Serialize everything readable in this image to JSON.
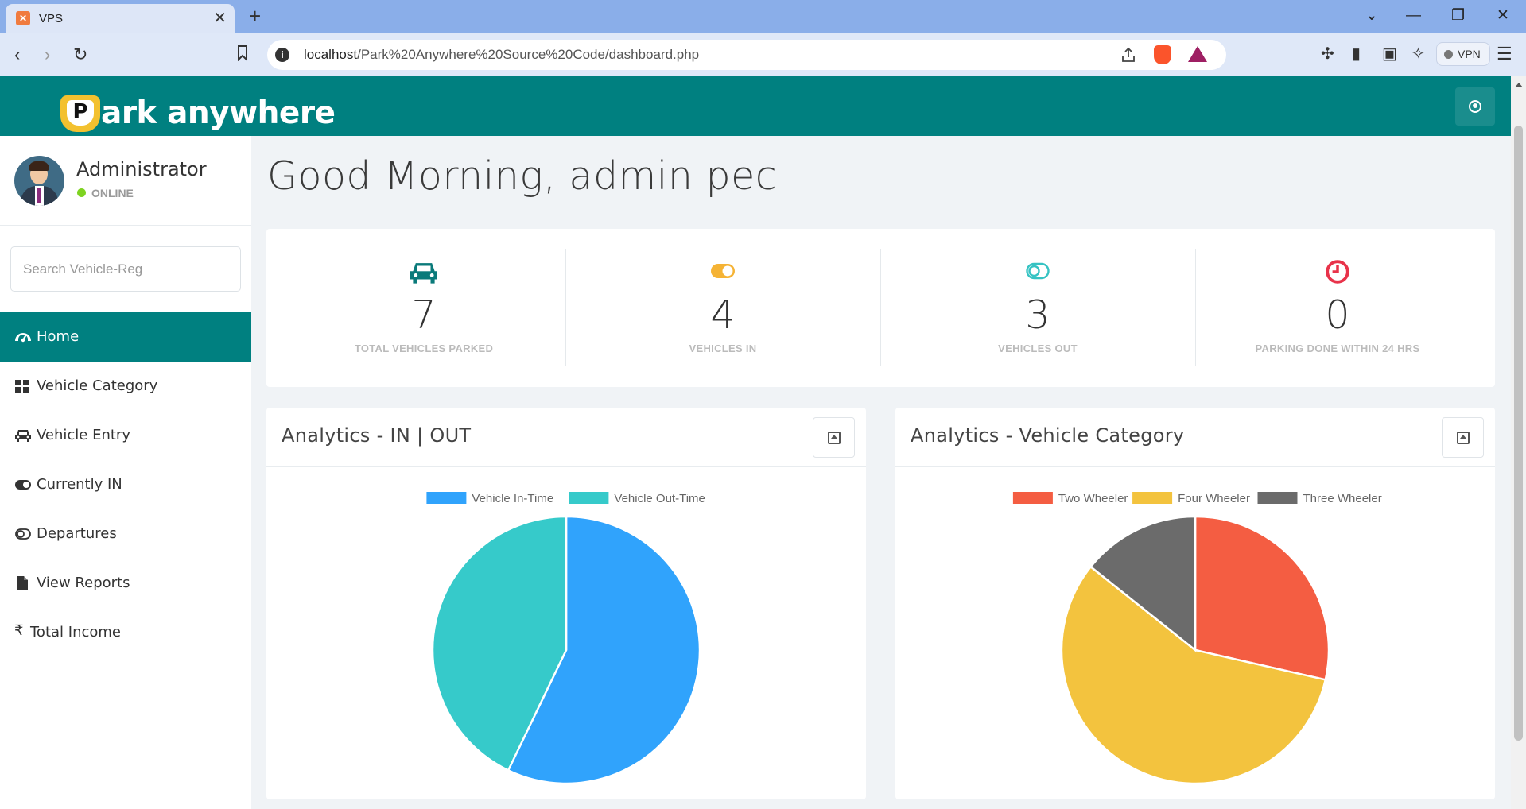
{
  "browser": {
    "tab_title": "VPS",
    "url_host": "localhost",
    "url_path": "/Park%20Anywhere%20Source%20Code/dashboard.php",
    "vpn_label": "VPN"
  },
  "header": {
    "logo_letter": "P",
    "logo_text": "ark anywhere"
  },
  "sidebar": {
    "profile_name": "Administrator",
    "status": "ONLINE",
    "search_placeholder": "Search Vehicle-Reg",
    "items": [
      {
        "label": "Home",
        "icon": "dashboard-icon"
      },
      {
        "label": "Vehicle Category",
        "icon": "grid-icon"
      },
      {
        "label": "Vehicle Entry",
        "icon": "car-icon"
      },
      {
        "label": "Currently IN",
        "icon": "toggle-on-icon"
      },
      {
        "label": "Departures",
        "icon": "toggle-off-icon"
      },
      {
        "label": "View Reports",
        "icon": "file-icon"
      },
      {
        "label": "Total Income",
        "icon": "rupee-icon"
      }
    ]
  },
  "main": {
    "greeting": "Good Morning, admin pec",
    "stats": [
      {
        "value": "7",
        "label": "TOTAL VEHICLES PARKED",
        "icon": "car-icon",
        "color": "#0a7a7a"
      },
      {
        "value": "4",
        "label": "VEHICLES IN",
        "icon": "toggle-on-icon",
        "color": "#f5b335"
      },
      {
        "value": "3",
        "label": "VEHICLES OUT",
        "icon": "toggle-off-icon",
        "color": "#36c3c3"
      },
      {
        "value": "0",
        "label": "PARKING DONE WITHIN 24 HRS",
        "icon": "clock-icon",
        "color": "#e8334a"
      }
    ],
    "panels": [
      {
        "title": "Analytics - IN | OUT"
      },
      {
        "title": "Analytics - Vehicle Category"
      }
    ]
  },
  "chart_data": [
    {
      "type": "pie",
      "title": "Analytics - IN | OUT",
      "series": [
        {
          "name": "Vehicle In-Time",
          "value": 4,
          "color": "#30a3fc"
        },
        {
          "name": "Vehicle Out-Time",
          "value": 3,
          "color": "#36caca"
        }
      ],
      "legend": "top"
    },
    {
      "type": "pie",
      "title": "Analytics - Vehicle Category",
      "series": [
        {
          "name": "Two Wheeler",
          "value": 2,
          "color": "#f45d42"
        },
        {
          "name": "Four Wheeler",
          "value": 4,
          "color": "#f3c33e"
        },
        {
          "name": "Three Wheeler",
          "value": 1,
          "color": "#6b6b6b"
        }
      ],
      "legend": "top"
    }
  ]
}
